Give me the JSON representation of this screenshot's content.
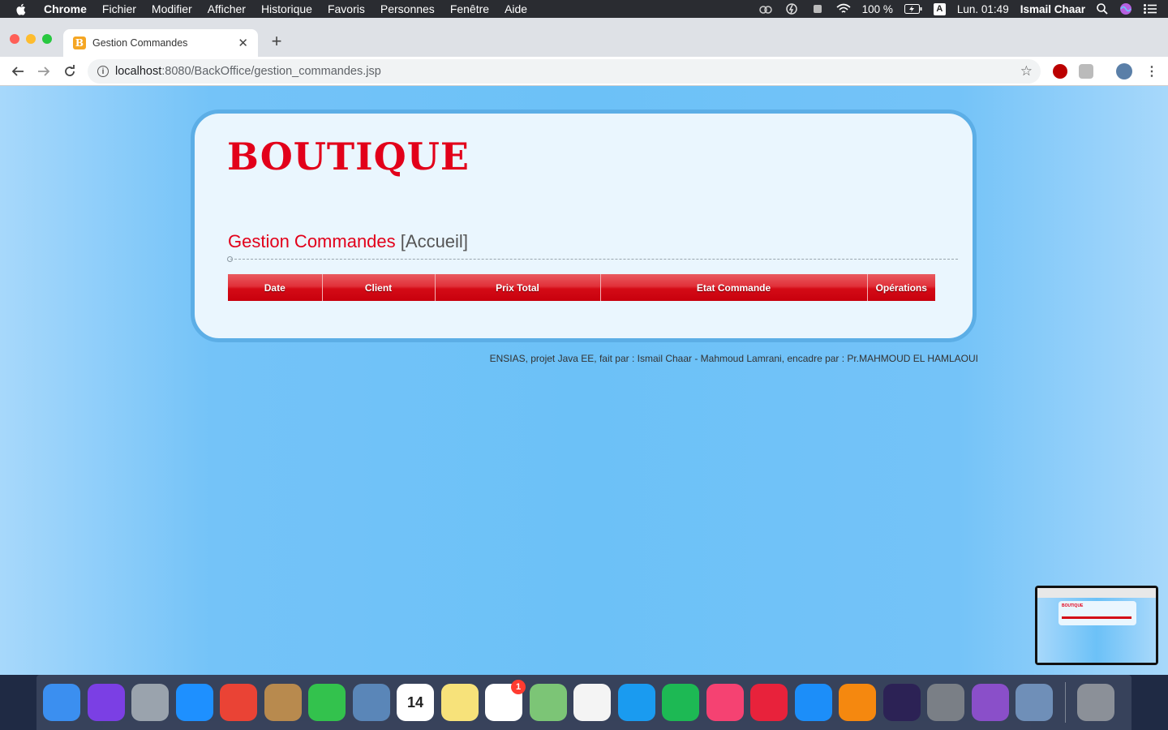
{
  "menubar": {
    "app": "Chrome",
    "items": [
      "Fichier",
      "Modifier",
      "Afficher",
      "Historique",
      "Favoris",
      "Personnes",
      "Fenêtre",
      "Aide"
    ],
    "battery": "100 %",
    "input_source": "A",
    "clock": "Lun. 01:49",
    "user": "Ismail Chaar"
  },
  "browser": {
    "tab_title": "Gestion Commandes",
    "tab_favicon": "B",
    "url_host": "localhost",
    "url_path": ":8080/BackOffice/gestion_commandes.jsp"
  },
  "page": {
    "logo": "BOUTIQUE",
    "section_title": "Gestion Commandes",
    "section_crumb": "[Accueil]",
    "table_headers": [
      "Date",
      "Client",
      "Prix Total",
      "Etat Commande",
      "Opérations"
    ],
    "footer": "ENSIAS, projet Java EE, fait par : Ismail Chaar - Mahmoud Lamrani, encadre par : Pr.MAHMOUD EL HAMLAOUI"
  },
  "thumbnail": {
    "logo": "BOUTIQUE"
  },
  "dock": {
    "items": [
      {
        "name": "finder-icon",
        "color": "#3b8ff0",
        "glyph": ""
      },
      {
        "name": "siri-icon",
        "color": "#7b3fe4",
        "glyph": ""
      },
      {
        "name": "launchpad-icon",
        "color": "#9aa3ad",
        "glyph": ""
      },
      {
        "name": "safari-icon",
        "color": "#1e90ff",
        "glyph": ""
      },
      {
        "name": "chrome-icon",
        "color": "#ea4335",
        "glyph": ""
      },
      {
        "name": "contacts-icon",
        "color": "#b88a4e",
        "glyph": ""
      },
      {
        "name": "facetime-icon",
        "color": "#33c24d",
        "glyph": ""
      },
      {
        "name": "preview-icon",
        "color": "#5a86b8",
        "glyph": ""
      },
      {
        "name": "calendar-icon",
        "color": "#ffffff",
        "glyph": "14"
      },
      {
        "name": "notes-icon",
        "color": "#f7e27a",
        "glyph": ""
      },
      {
        "name": "reminders-icon",
        "color": "#ffffff",
        "glyph": "",
        "badge": "1"
      },
      {
        "name": "maps-icon",
        "color": "#7cc576",
        "glyph": ""
      },
      {
        "name": "photos-icon",
        "color": "#f4f4f4",
        "glyph": ""
      },
      {
        "name": "messages-icon",
        "color": "#1a9bf0",
        "glyph": ""
      },
      {
        "name": "spotify-icon",
        "color": "#1db954",
        "glyph": ""
      },
      {
        "name": "music-icon",
        "color": "#f54272",
        "glyph": ""
      },
      {
        "name": "mongodb-compass-icon",
        "color": "#e8223b",
        "glyph": ""
      },
      {
        "name": "app-store-icon",
        "color": "#1c8ef9",
        "glyph": ""
      },
      {
        "name": "books-icon",
        "color": "#f5880f",
        "glyph": ""
      },
      {
        "name": "eclipse-icon",
        "color": "#2c2255",
        "glyph": ""
      },
      {
        "name": "sequel-pro-icon",
        "color": "#7a7f86",
        "glyph": ""
      },
      {
        "name": "github-desktop-icon",
        "color": "#8a4fc9",
        "glyph": ""
      },
      {
        "name": "image-capture-icon",
        "color": "#6f8fb8",
        "glyph": ""
      }
    ]
  }
}
